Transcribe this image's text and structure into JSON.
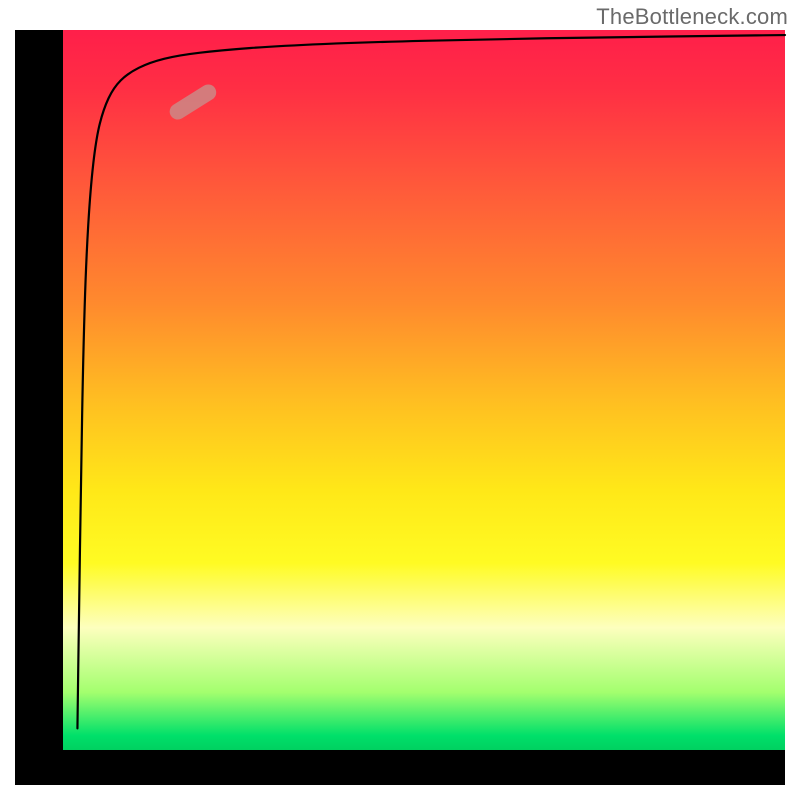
{
  "attribution": "TheBottleneck.com",
  "chart_data": {
    "type": "line",
    "title": "",
    "xlabel": "",
    "ylabel": "",
    "xlim": [
      0,
      100
    ],
    "ylim": [
      0,
      100
    ],
    "grid": false,
    "background": "rainbow-gradient-vertical",
    "series": [
      {
        "name": "curve",
        "x": [
          2.0,
          2.2,
          2.5,
          2.8,
          3.2,
          3.8,
          4.6,
          5.6,
          7,
          9,
          12,
          16,
          22,
          30,
          42,
          58,
          76,
          92,
          100
        ],
        "y": [
          3,
          18,
          38,
          55,
          68,
          78,
          85,
          89,
          92,
          94,
          95.5,
          96.5,
          97.2,
          97.8,
          98.3,
          98.7,
          99.0,
          99.2,
          99.3
        ]
      }
    ],
    "marker": {
      "x_pct": 18,
      "y_pct": 90,
      "shape": "rounded",
      "color": "#cc8886"
    }
  }
}
